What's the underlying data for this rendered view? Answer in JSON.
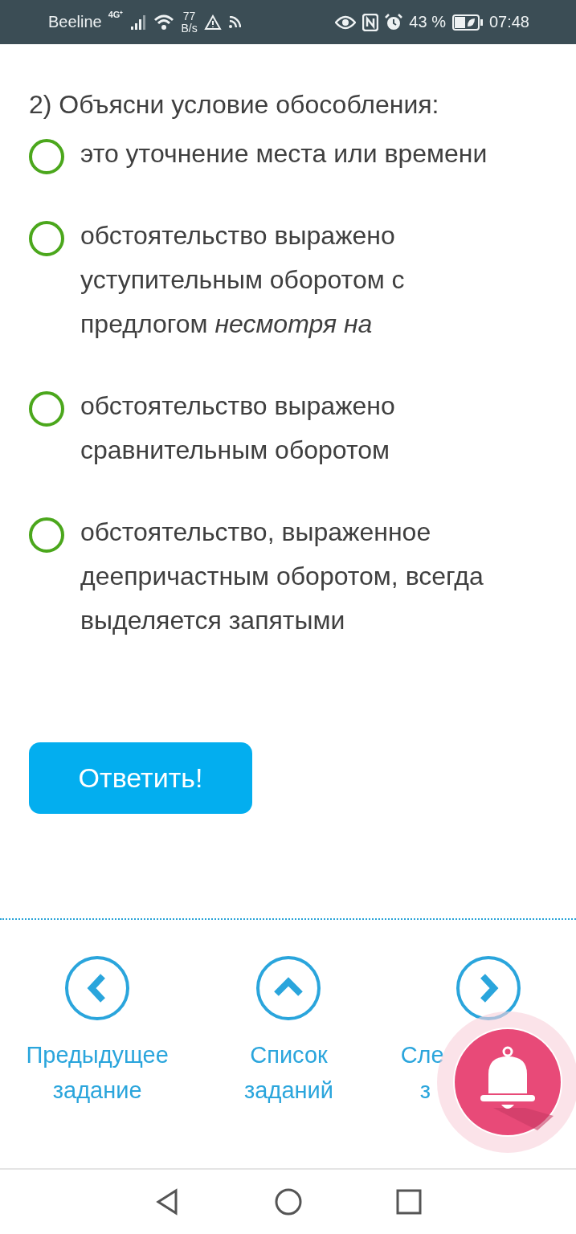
{
  "status_bar": {
    "carrier": "Beeline",
    "network": "4G⁺",
    "speed_value": "77",
    "speed_unit": "B/s",
    "battery": "43 %",
    "time": "07:48"
  },
  "question": {
    "title": "2) Объясни условие обособления:",
    "options": [
      {
        "text": "это уточнение места или времени",
        "selected": false
      },
      {
        "text": "обстоятельство выражено уступительным оборотом с предлогом *несмотря на*",
        "selected": false
      },
      {
        "text": "обстоятельство выражено сравнительным оборотом",
        "selected": false
      },
      {
        "text": "обстоятельство, выраженное деепричастным оборотом, всегда выделяется запятыми",
        "selected": false
      }
    ]
  },
  "submit_button": {
    "label": "Ответить!"
  },
  "task_nav": [
    {
      "kind": "prev",
      "line1": "Предыдущее",
      "line2": "задание"
    },
    {
      "kind": "list",
      "line1": "Список",
      "line2": "заданий"
    },
    {
      "kind": "next",
      "line1": "Сле",
      "line2": "з"
    }
  ]
}
